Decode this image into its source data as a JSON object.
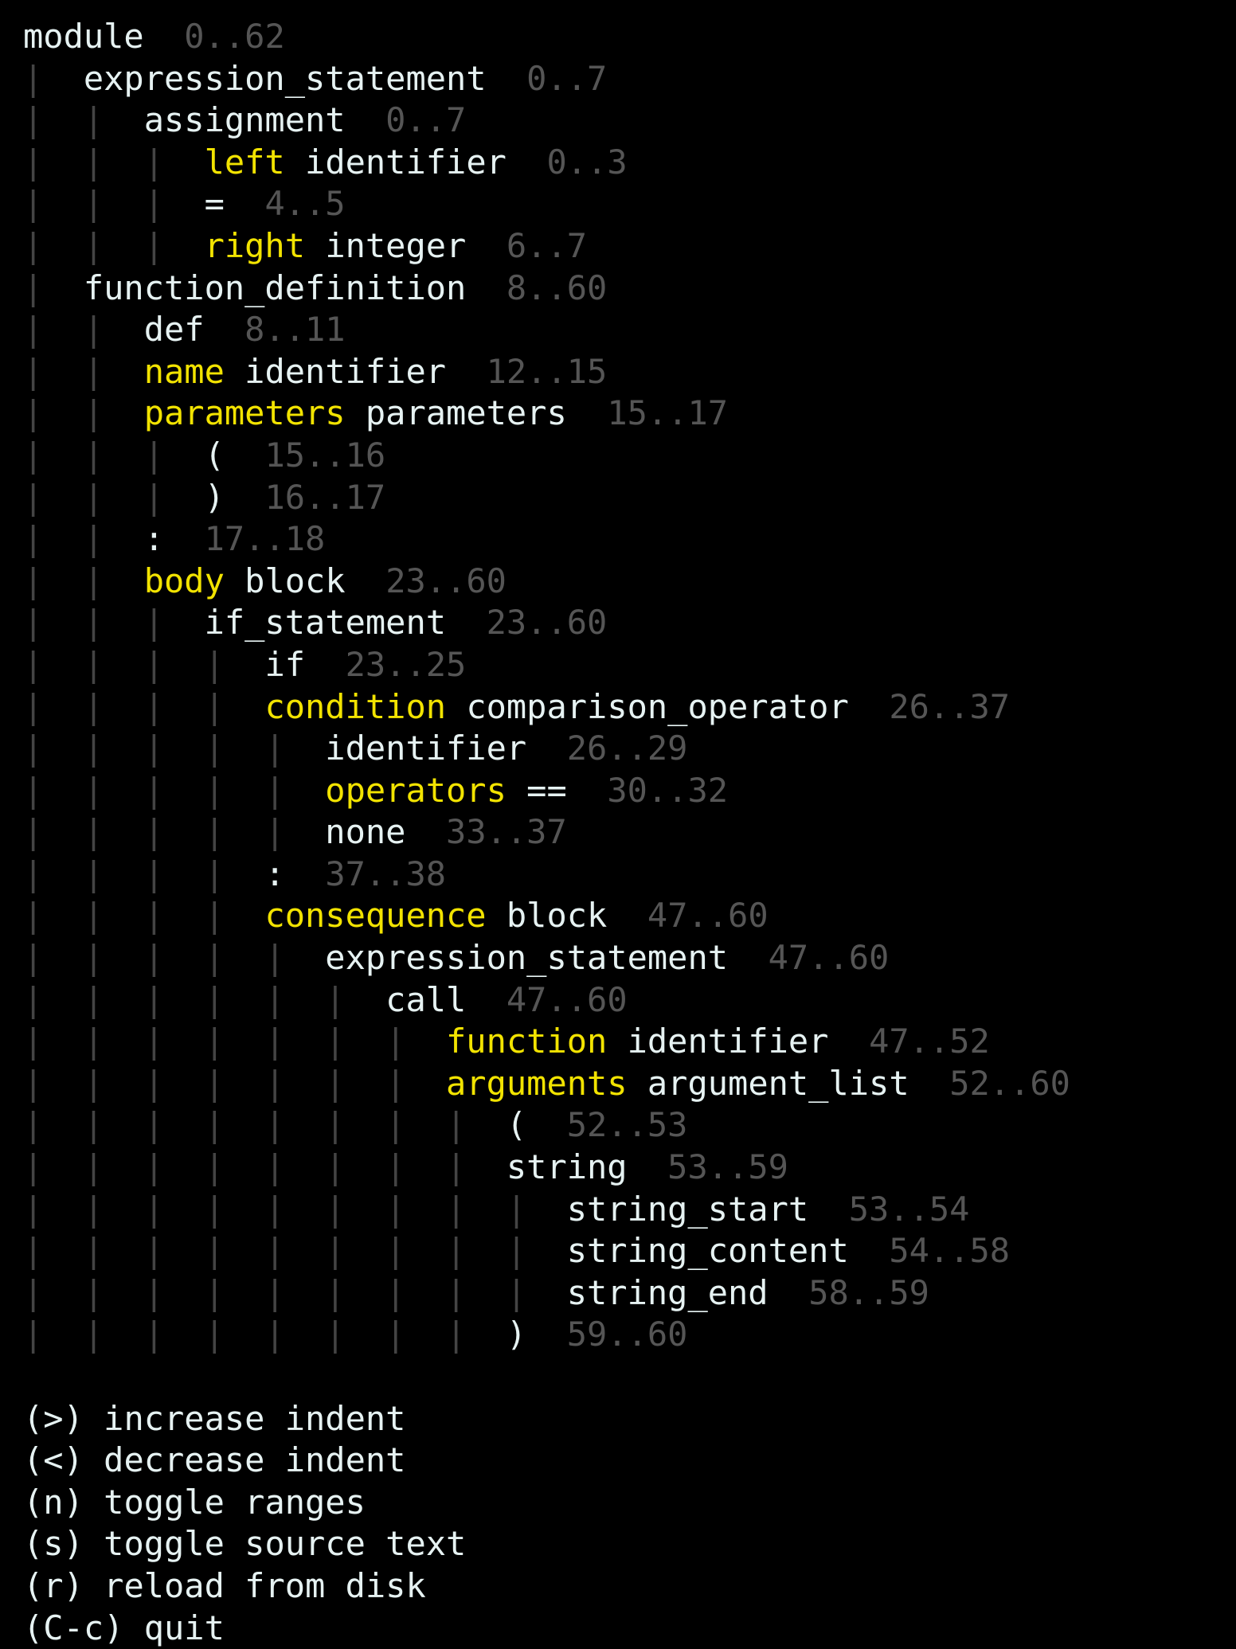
{
  "colors": {
    "background": "#000000",
    "text": "#e6f2f2",
    "field": "#f2e300",
    "range": "#555555",
    "tree_guide": "#444444"
  },
  "tree": [
    {
      "depth": 0,
      "field": "",
      "kind": "module",
      "range": "0..62"
    },
    {
      "depth": 1,
      "field": "",
      "kind": "expression_statement",
      "range": "0..7"
    },
    {
      "depth": 2,
      "field": "",
      "kind": "assignment",
      "range": "0..7"
    },
    {
      "depth": 3,
      "field": "left",
      "kind": "identifier",
      "range": "0..3"
    },
    {
      "depth": 3,
      "field": "",
      "kind": "=",
      "range": "4..5"
    },
    {
      "depth": 3,
      "field": "right",
      "kind": "integer",
      "range": "6..7"
    },
    {
      "depth": 1,
      "field": "",
      "kind": "function_definition",
      "range": "8..60"
    },
    {
      "depth": 2,
      "field": "",
      "kind": "def",
      "range": "8..11"
    },
    {
      "depth": 2,
      "field": "name",
      "kind": "identifier",
      "range": "12..15"
    },
    {
      "depth": 2,
      "field": "parameters",
      "kind": "parameters",
      "range": "15..17"
    },
    {
      "depth": 3,
      "field": "",
      "kind": "(",
      "range": "15..16"
    },
    {
      "depth": 3,
      "field": "",
      "kind": ")",
      "range": "16..17"
    },
    {
      "depth": 2,
      "field": "",
      "kind": ":",
      "range": "17..18"
    },
    {
      "depth": 2,
      "field": "body",
      "kind": "block",
      "range": "23..60"
    },
    {
      "depth": 3,
      "field": "",
      "kind": "if_statement",
      "range": "23..60"
    },
    {
      "depth": 4,
      "field": "",
      "kind": "if",
      "range": "23..25"
    },
    {
      "depth": 4,
      "field": "condition",
      "kind": "comparison_operator",
      "range": "26..37"
    },
    {
      "depth": 5,
      "field": "",
      "kind": "identifier",
      "range": "26..29"
    },
    {
      "depth": 5,
      "field": "operators",
      "kind": "==",
      "range": "30..32"
    },
    {
      "depth": 5,
      "field": "",
      "kind": "none",
      "range": "33..37"
    },
    {
      "depth": 4,
      "field": "",
      "kind": ":",
      "range": "37..38"
    },
    {
      "depth": 4,
      "field": "consequence",
      "kind": "block",
      "range": "47..60"
    },
    {
      "depth": 5,
      "field": "",
      "kind": "expression_statement",
      "range": "47..60"
    },
    {
      "depth": 6,
      "field": "",
      "kind": "call",
      "range": "47..60"
    },
    {
      "depth": 7,
      "field": "function",
      "kind": "identifier",
      "range": "47..52"
    },
    {
      "depth": 7,
      "field": "arguments",
      "kind": "argument_list",
      "range": "52..60"
    },
    {
      "depth": 8,
      "field": "",
      "kind": "(",
      "range": "52..53"
    },
    {
      "depth": 8,
      "field": "",
      "kind": "string",
      "range": "53..59"
    },
    {
      "depth": 9,
      "field": "",
      "kind": "string_start",
      "range": "53..54"
    },
    {
      "depth": 9,
      "field": "",
      "kind": "string_content",
      "range": "54..58"
    },
    {
      "depth": 9,
      "field": "",
      "kind": "string_end",
      "range": "58..59"
    },
    {
      "depth": 8,
      "field": "",
      "kind": ")",
      "range": "59..60"
    }
  ],
  "help": [
    {
      "key": "(>)",
      "label": "increase indent"
    },
    {
      "key": "(<)",
      "label": "decrease indent"
    },
    {
      "key": "(n)",
      "label": "toggle ranges"
    },
    {
      "key": "(s)",
      "label": "toggle source text"
    },
    {
      "key": "(r)",
      "label": "reload from disk"
    },
    {
      "key": "(C-c)",
      "label": "quit"
    }
  ]
}
